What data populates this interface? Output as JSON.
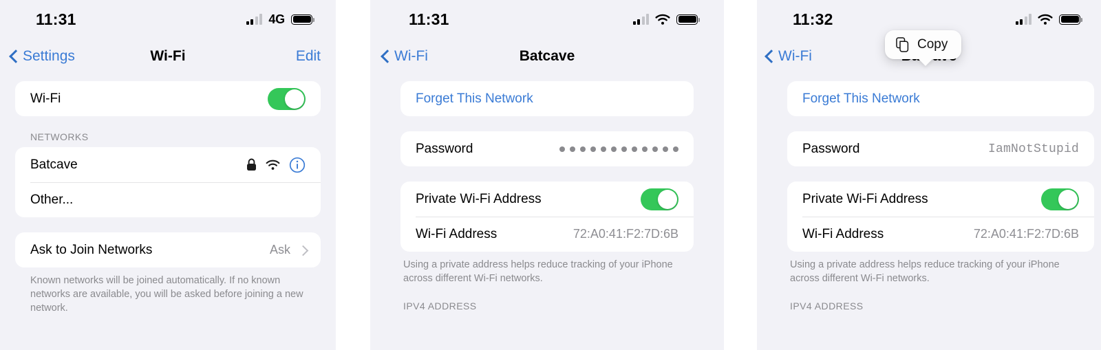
{
  "panels": [
    {
      "status": {
        "time": "11:31",
        "network": "4G",
        "icons": [
          "signal-bars",
          "battery"
        ]
      },
      "nav": {
        "back": "Settings",
        "title": "Wi-Fi",
        "action": "Edit"
      },
      "wifi_toggle": {
        "label": "Wi-Fi",
        "state": "on"
      },
      "networks_header": "NETWORKS",
      "networks": [
        {
          "name": "Batcave",
          "icons": [
            "lock-icon",
            "wifi-icon",
            "info-icon"
          ]
        },
        {
          "name": "Other...",
          "icons": []
        }
      ],
      "ask_to_join": {
        "label": "Ask to Join Networks",
        "value": "Ask"
      },
      "footnote": "Known networks will be joined automatically. If no known networks are available, you will be asked before joining a new network."
    },
    {
      "status": {
        "time": "11:31",
        "icons": [
          "signal-bars",
          "wifi-icon",
          "battery"
        ]
      },
      "nav": {
        "back": "Wi-Fi",
        "title": "Batcave"
      },
      "forget": "Forget This Network",
      "password": {
        "label": "Password",
        "masked": true,
        "dot_count": 12
      },
      "private_address": {
        "label": "Private Wi-Fi Address",
        "state": "on"
      },
      "wifi_address": {
        "label": "Wi-Fi Address",
        "value": "72:A0:41:F2:7D:6B"
      },
      "footnote": "Using a private address helps reduce tracking of your iPhone across different Wi-Fi networks.",
      "ipv4_header": "IPV4 ADDRESS"
    },
    {
      "status": {
        "time": "11:32",
        "icons": [
          "signal-bars",
          "wifi-icon",
          "battery"
        ]
      },
      "nav": {
        "back": "Wi-Fi",
        "title": "Batcave"
      },
      "forget": "Forget This Network",
      "tooltip": {
        "label": "Copy",
        "icon": "copy-icon"
      },
      "password": {
        "label": "Password",
        "value": "IamNotStupid",
        "masked": false
      },
      "private_address": {
        "label": "Private Wi-Fi Address",
        "state": "on"
      },
      "wifi_address": {
        "label": "Wi-Fi Address",
        "value": "72:A0:41:F2:7D:6B"
      },
      "footnote": "Using a private address helps reduce tracking of your iPhone across different Wi-Fi networks.",
      "ipv4_header": "IPV4 ADDRESS"
    }
  ],
  "colors": {
    "accent_blue": "#3a7bd5",
    "toggle_green": "#34C759",
    "background": "#F2F2F7",
    "card": "#FFFFFF",
    "secondary_text": "#8E8E93"
  }
}
